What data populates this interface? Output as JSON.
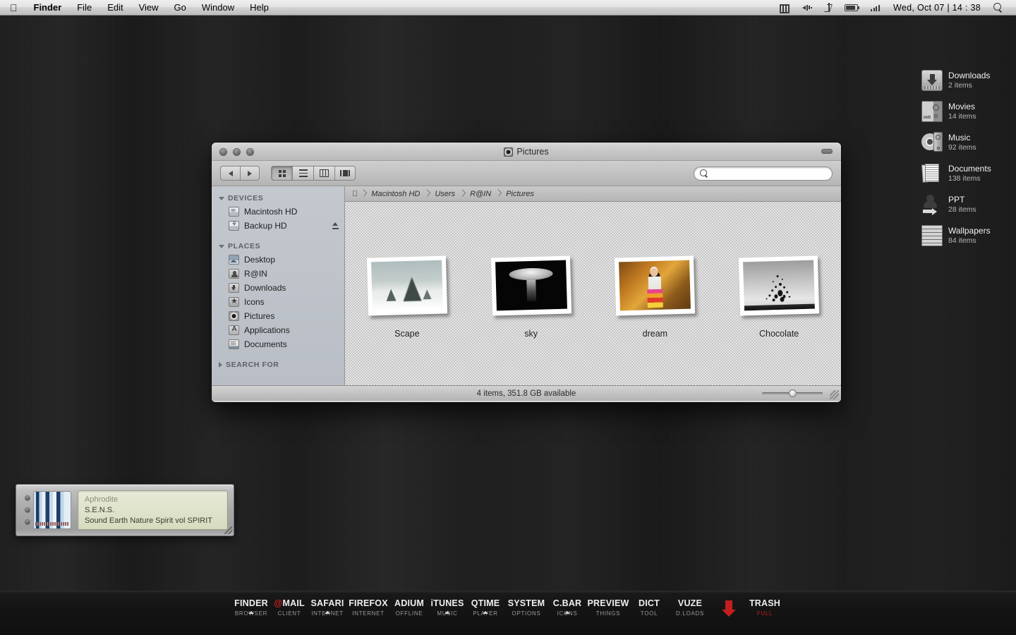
{
  "menubar": {
    "apple_logo": "apple-logo",
    "items": [
      {
        "label": "Finder",
        "bold": true
      },
      {
        "label": "File",
        "bold": false
      },
      {
        "label": "Edit",
        "bold": false
      },
      {
        "label": "View",
        "bold": false
      },
      {
        "label": "Go",
        "bold": false
      },
      {
        "label": "Window",
        "bold": false
      },
      {
        "label": "Help",
        "bold": false
      }
    ],
    "status_icons": [
      "sync-icon",
      "volume-icon",
      "bluetooth-icon",
      "battery-icon",
      "signal-bars-icon"
    ],
    "clock": "Wed, Oct  07 | 14 : 38",
    "search_icon": "spotlight-search-icon"
  },
  "desktop_stacks": [
    {
      "title": "Downloads",
      "count": "2 items",
      "icon": "downloads-drive-icon"
    },
    {
      "title": "Movies",
      "count": "14 items",
      "icon": "dvd-case-icon"
    },
    {
      "title": "Music",
      "count": "92 items",
      "icon": "cd-disc-icon"
    },
    {
      "title": "Documents",
      "count": "138 items",
      "icon": "documents-stack-icon"
    },
    {
      "title": "PPT",
      "count": "28 items",
      "icon": "person-arrow-icon"
    },
    {
      "title": "Wallpapers",
      "count": "84 items",
      "icon": "brick-wall-icon"
    }
  ],
  "finder": {
    "title": "Pictures",
    "title_icon": "pictures-folder-icon",
    "traffic_lights": [
      "close-button",
      "minimize-button",
      "zoom-button"
    ],
    "minimize_widget": "window-minimize-pill",
    "nav": {
      "back": "back-arrow-icon",
      "forward": "forward-arrow-icon"
    },
    "view_modes": [
      {
        "name": "icon-view",
        "active": true
      },
      {
        "name": "list-view",
        "active": false
      },
      {
        "name": "column-view",
        "active": false
      },
      {
        "name": "coverflow-view",
        "active": false
      }
    ],
    "search": {
      "value": "",
      "placeholder": ""
    },
    "breadcrumb": [
      "Macintosh HD",
      "Users",
      "R@IN",
      "Pictures"
    ],
    "sidebar": [
      {
        "header": "DEVICES",
        "expanded": true,
        "items": [
          {
            "label": "Macintosh HD",
            "icon": "hard-drive-icon",
            "eject": false
          },
          {
            "label": "Backup HD",
            "icon": "backup-drive-icon",
            "eject": true
          }
        ]
      },
      {
        "header": "PLACES",
        "expanded": true,
        "items": [
          {
            "label": "Desktop",
            "icon": "desktop-icon",
            "eject": false
          },
          {
            "label": "R@IN",
            "icon": "home-folder-icon",
            "eject": false
          },
          {
            "label": "Downloads",
            "icon": "downloads-folder-icon",
            "eject": false
          },
          {
            "label": "Icons",
            "icon": "icons-folder-icon",
            "eject": false
          },
          {
            "label": "Pictures",
            "icon": "pictures-folder-icon",
            "eject": false
          },
          {
            "label": "Applications",
            "icon": "applications-folder-icon",
            "eject": false
          },
          {
            "label": "Documents",
            "icon": "documents-folder-icon",
            "eject": false
          }
        ]
      },
      {
        "header": "SEARCH FOR",
        "expanded": false,
        "items": []
      }
    ],
    "files": [
      {
        "name": "Scape",
        "thumbnail": "snowy-trees-photo"
      },
      {
        "name": "sky",
        "thumbnail": "umbrella-figure-photo"
      },
      {
        "name": "dream",
        "thumbnail": "girl-autumn-photo"
      },
      {
        "name": "Chocolate",
        "thumbnail": "splash-photo"
      }
    ],
    "status": "4 items, 351.8  GB available",
    "zoom_slider": {
      "name": "icon-size-slider",
      "value": 45
    },
    "resizer": "window-resize-grip"
  },
  "music_widget": {
    "track": "Aphrodite",
    "artist": "S.E.N.S.",
    "album": "Sound  Earth  Nature  Spirit  vol  SPIRIT",
    "buttons": [
      "widget-button-1",
      "widget-button-2",
      "widget-button-3"
    ],
    "artwork": "album-artwork",
    "resizer": "widget-resize-grip"
  },
  "dock": {
    "items": [
      {
        "label": "FINDER",
        "sub": "BROWSER",
        "running": true,
        "accent": false
      },
      {
        "label": "@MAIL",
        "sub": "CLIENT",
        "running": false,
        "accent": true
      },
      {
        "label": "SAFARI",
        "sub": "INTERNET",
        "running": true,
        "accent": false
      },
      {
        "label": "FIREFOX",
        "sub": "INTERNET",
        "running": false,
        "accent": false
      },
      {
        "label": "ADIUM",
        "sub": "OFFLINE",
        "running": false,
        "accent": false
      },
      {
        "label": "iTUNES",
        "sub": "MUSIC",
        "running": true,
        "accent": false
      },
      {
        "label": "QTIME",
        "sub": "PLAYER",
        "running": true,
        "accent": false
      },
      {
        "label": "SYSTEM",
        "sub": "OPTIONS",
        "running": false,
        "accent": false
      },
      {
        "label": "C.BAR",
        "sub": "ICONS",
        "running": true,
        "accent": false
      },
      {
        "label": "PREVIEW",
        "sub": "THINGS",
        "running": false,
        "accent": false
      },
      {
        "label": "DICT",
        "sub": "TOOL",
        "running": false,
        "accent": false
      },
      {
        "label": "VUZE",
        "sub": "D.LOADS",
        "running": false,
        "accent": false
      }
    ],
    "separator_icon": "red-down-arrow-icon",
    "trash": {
      "label": "TRASH",
      "sub": "FULL"
    }
  },
  "colors": {
    "accent_red": "#c41f1f",
    "desktop_bg": "#1c1c1c",
    "dock_bg": "#141414",
    "sidebar_bg": "#bec3ca"
  }
}
